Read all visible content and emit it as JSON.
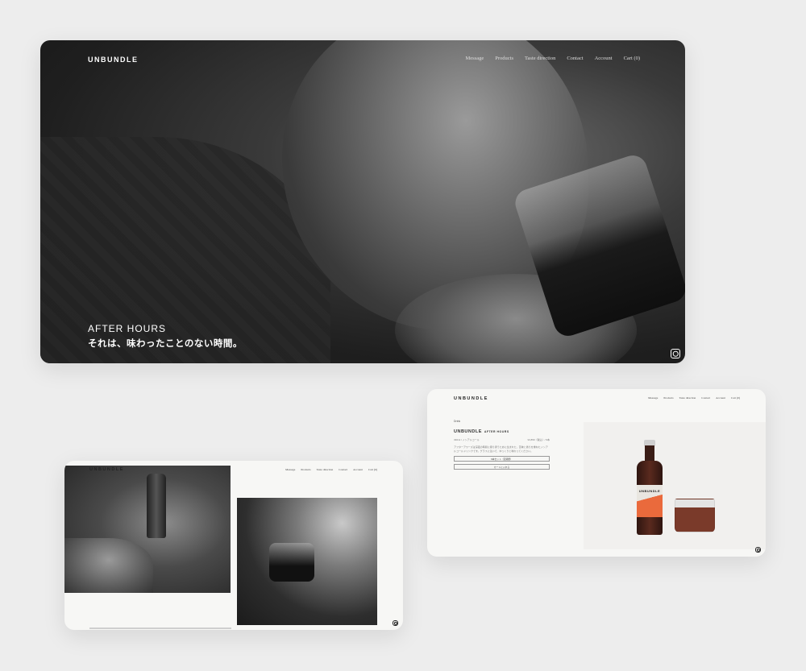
{
  "brand": "UNBUNDLE",
  "hero": {
    "nav": [
      "Message",
      "Products",
      "Taste direction",
      "Contact",
      "Account",
      "Cart (0)"
    ],
    "tagline_en": "AFTER HOURS",
    "tagline_jp": "それは、味わったことのない時間。"
  },
  "product_page": {
    "nav": [
      "Message",
      "Products",
      "Taste direction",
      "Contact",
      "Account",
      "Cart (0)"
    ],
    "breadcrumb": "Drink",
    "title": "UNBUNDLE",
    "subtitle": "AFTER HOURS",
    "meta_left": "330ml / ノンアルコール",
    "meta_right": "¥3,850（税込）/ 6本",
    "description": "アフターアワーズは深夜の時間に寄り添うために生まれた、苦味と香りを重ねたノンアルコールドリンクです。グラスに注いで、ゆっくりと味わってください。",
    "option_button": "6本セット（定期便）",
    "cart_button": "カートに入れる",
    "bottle_label": "UNBUNDLE"
  },
  "lower_page": {
    "nav": [
      "Message",
      "Products",
      "Taste direction",
      "Contact",
      "Account",
      "Cart (0)"
    ]
  }
}
